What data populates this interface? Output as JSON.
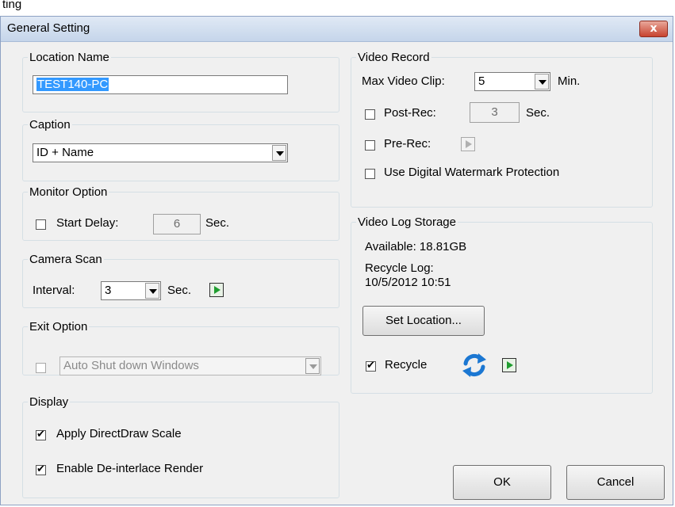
{
  "outside_text": "ting",
  "window": {
    "title": "General Setting",
    "close_glyph": "x"
  },
  "location": {
    "legend": "Location Name",
    "value": "TEST140-PC"
  },
  "caption": {
    "legend": "Caption",
    "selected": "ID + Name"
  },
  "monitor": {
    "legend": "Monitor Option",
    "start_delay_label": "Start Delay:",
    "start_delay_value": "6",
    "unit": "Sec.",
    "start_delay_checked": false
  },
  "camera_scan": {
    "legend": "Camera Scan",
    "interval_label": "Interval:",
    "interval_value": "3",
    "unit": "Sec.",
    "play_icon": "play-icon"
  },
  "exit": {
    "legend": "Exit Option",
    "selected": "Auto Shut down Windows",
    "checked": false
  },
  "display": {
    "legend": "Display",
    "directdraw_label": "Apply DirectDraw Scale",
    "directdraw_checked": true,
    "deinterlace_label": "Enable De-interlace Render",
    "deinterlace_checked": true
  },
  "video_record": {
    "legend": "Video Record",
    "max_clip_label": "Max Video Clip:",
    "max_clip_value": "5",
    "max_clip_unit": "Min.",
    "post_rec_label": "Post-Rec:",
    "post_rec_value": "3",
    "post_rec_unit": "Sec.",
    "post_rec_checked": false,
    "pre_rec_label": "Pre-Rec:",
    "pre_rec_checked": false,
    "watermark_label": "Use Digital Watermark Protection",
    "watermark_checked": false
  },
  "video_log": {
    "legend": "Video Log Storage",
    "available": "Available: 18.81GB",
    "recycle_log_label": "Recycle Log:",
    "recycle_log_date": "10/5/2012 10:51",
    "set_location_label": "Set Location...",
    "recycle_label": "Recycle",
    "recycle_checked": true,
    "recycle_icon": "refresh-icon"
  },
  "buttons": {
    "ok": "OK",
    "cancel": "Cancel"
  },
  "colors": {
    "selection": "#3399ff",
    "play_green": "#1f9d2f",
    "refresh_blue": "#1b77d2",
    "close_red": "#c7432f"
  }
}
